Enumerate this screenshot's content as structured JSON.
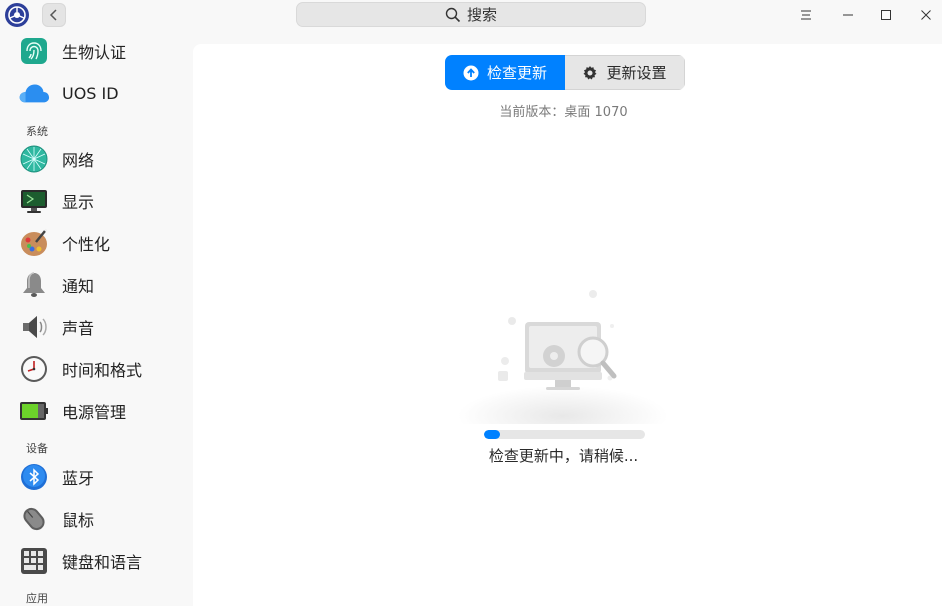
{
  "titlebar": {
    "search_label": "搜索",
    "icons": [
      "app-logo",
      "back-arrow",
      "search-icon",
      "menu-icon",
      "minimize-icon",
      "maximize-icon",
      "close-icon"
    ]
  },
  "sidebar": {
    "items_top": [
      {
        "label": "生物认证",
        "icon": "biometric-icon"
      },
      {
        "label": "UOS ID",
        "icon": "cloud-icon"
      }
    ],
    "section_system": "系统",
    "items_system": [
      {
        "label": "网络",
        "icon": "network-icon"
      },
      {
        "label": "显示",
        "icon": "display-icon"
      },
      {
        "label": "个性化",
        "icon": "personalization-icon"
      },
      {
        "label": "通知",
        "icon": "bell-icon"
      },
      {
        "label": "声音",
        "icon": "speaker-icon"
      },
      {
        "label": "时间和格式",
        "icon": "clock-icon"
      },
      {
        "label": "电源管理",
        "icon": "battery-icon"
      }
    ],
    "section_devices": "设备",
    "items_devices": [
      {
        "label": "蓝牙",
        "icon": "bluetooth-icon"
      },
      {
        "label": "鼠标",
        "icon": "mouse-icon"
      },
      {
        "label": "键盘和语言",
        "icon": "keyboard-icon"
      }
    ],
    "section_apps": "应用"
  },
  "main": {
    "check_update_label": "检查更新",
    "update_settings_label": "更新设置",
    "version_text": "当前版本：桌面 1070",
    "status_text": "检查更新中，请稍候...",
    "progress": 0.1,
    "accent_color": "#0081ff"
  }
}
